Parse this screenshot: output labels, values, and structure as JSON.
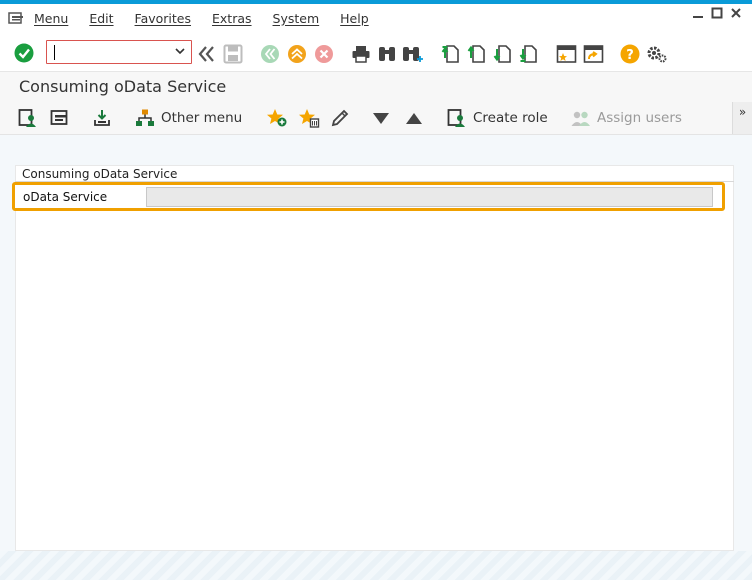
{
  "menubar": {
    "items": [
      "Menu",
      "Edit",
      "Favorites",
      "Extras",
      "System",
      "Help"
    ]
  },
  "command_field": {
    "value": ""
  },
  "page": {
    "title": "Consuming oData Service"
  },
  "app_toolbar": {
    "other_menu": "Other menu",
    "create_role": "Create role",
    "assign_users": "Assign users"
  },
  "group": {
    "title": "Consuming oData Service",
    "field_label": "oData Service",
    "field_value": ""
  },
  "colors": {
    "accent_top": "#0a9bd8",
    "highlight": "#f0a000",
    "enter_green": "#1a9e3f",
    "help_orange": "#f5a500"
  },
  "icons": {
    "menu": "menu-icon",
    "enter": "enter-checkmark-icon",
    "back": "back-double-chevron-icon",
    "save": "save-icon",
    "exit": "exit-icon",
    "up": "up-icon",
    "cancel": "cancel-icon",
    "print": "print-icon",
    "find": "binoculars-icon",
    "help": "help-icon",
    "settings": "gear-icon"
  }
}
